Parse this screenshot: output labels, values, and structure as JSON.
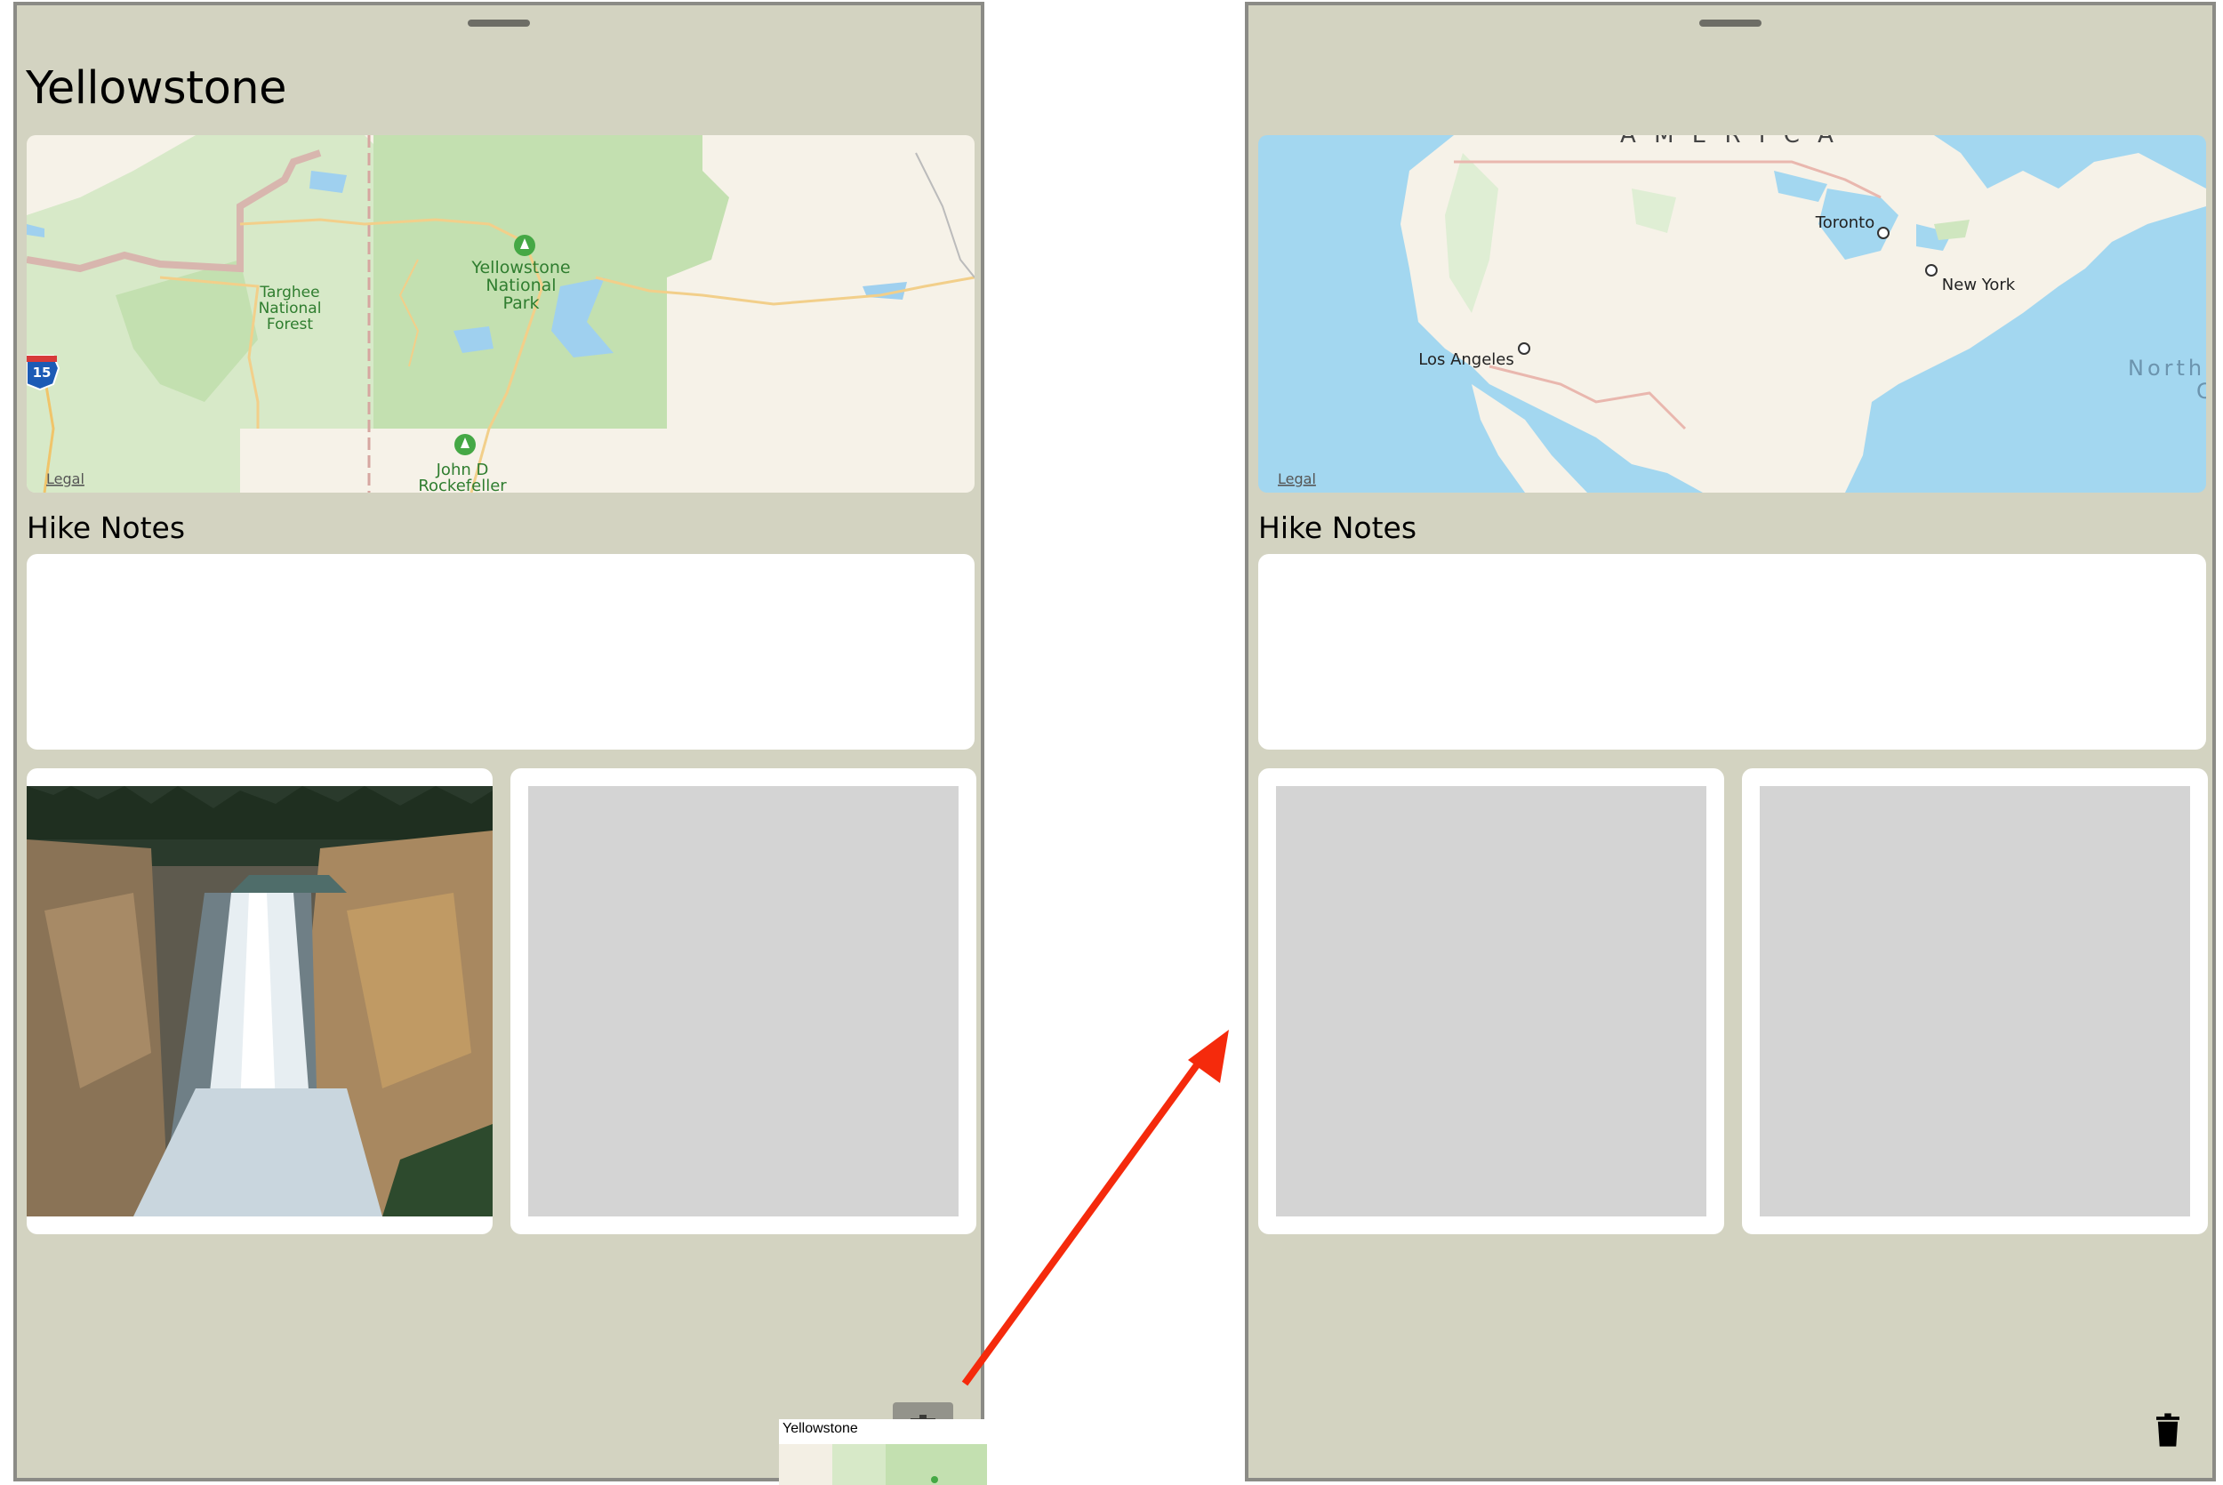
{
  "left_screen": {
    "title": "Yellowstone",
    "map": {
      "labels": [
        "Targhee",
        "National",
        "Forest",
        "Yellowstone",
        "National",
        "Park",
        "John D",
        "Rockefeller"
      ],
      "highway_shield": "15",
      "legal": "Legal"
    },
    "notes_label": "Hike Notes",
    "photos": [
      {
        "kind": "photo",
        "description_icon": "waterfall-photo"
      },
      {
        "kind": "placeholder"
      }
    ],
    "drag_preview_label": "Yellowstone",
    "trash_icon": "trash-icon"
  },
  "right_screen": {
    "map": {
      "labels": [
        "A M E R I C A",
        "Toronto",
        "New York",
        "Los Angeles",
        "North",
        "C"
      ],
      "legal": "Legal"
    },
    "notes_label": "Hike Notes",
    "photos": [
      {
        "kind": "placeholder"
      },
      {
        "kind": "placeholder"
      }
    ],
    "trash_icon": "trash-icon"
  },
  "colors": {
    "background": "#d3d3c1",
    "arrow": "#f52a0c",
    "placeholder": "#d4d4d4",
    "ocean": "#a3d7f0",
    "land": "#f6f2e8",
    "park": "#c3e0b0"
  }
}
